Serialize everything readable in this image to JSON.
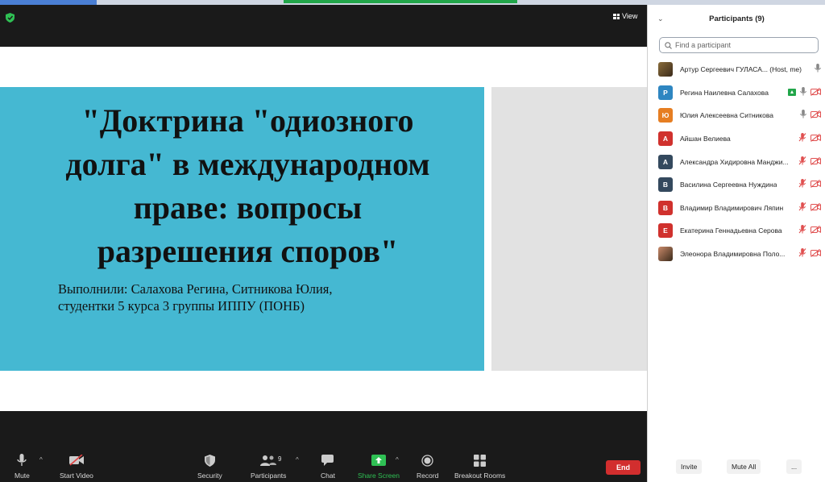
{
  "view_button": {
    "label": "View"
  },
  "slide": {
    "title_lines": [
      "\"Доктрина \"одиозного",
      "долга\" в международном",
      "праве: вопросы",
      "разрешения споров\""
    ],
    "authors_lines": [
      "Выполнили: Салахова Регина, Ситникова Юлия,",
      "студентки 5 курса 3 группы ИППУ (ПОНБ)"
    ]
  },
  "toolbar": {
    "mute": "Mute",
    "start_video": "Start Video",
    "security": "Security",
    "participants": "Participants",
    "participants_count": "9",
    "chat": "Chat",
    "share_screen": "Share Screen",
    "record": "Record",
    "breakout_rooms": "Breakout Rooms",
    "end": "End"
  },
  "panel": {
    "title": "Participants (9)",
    "search_placeholder": "Find a participant",
    "participants": [
      {
        "name": "Артур Сергеевич ГУЛАСА... (Host, me)",
        "initial": "",
        "color": "#8a6d3b",
        "photo": true,
        "sharing": false,
        "mic": "on",
        "video": "none"
      },
      {
        "name": "Регина Наилевна Салахова",
        "initial": "Р",
        "color": "#2e86c1",
        "photo": false,
        "sharing": true,
        "mic": "on",
        "video": "off"
      },
      {
        "name": "Юлия Алексеевна Ситникова",
        "initial": "Ю",
        "color": "#e67e22",
        "photo": false,
        "sharing": false,
        "mic": "on",
        "video": "off"
      },
      {
        "name": "Айшан Велиева",
        "initial": "А",
        "color": "#d0312d",
        "photo": false,
        "sharing": false,
        "mic": "muted",
        "video": "off"
      },
      {
        "name": "Александра Хидировна Манджи...",
        "initial": "А",
        "color": "#34495e",
        "photo": false,
        "sharing": false,
        "mic": "muted",
        "video": "off"
      },
      {
        "name": "Василина Сергеевна Нуждина",
        "initial": "В",
        "color": "#34495e",
        "photo": false,
        "sharing": false,
        "mic": "muted",
        "video": "off"
      },
      {
        "name": "Владимир Владимирович Ляпин",
        "initial": "В",
        "color": "#d0312d",
        "photo": false,
        "sharing": false,
        "mic": "muted",
        "video": "off"
      },
      {
        "name": "Екатерина Геннадьевна Серова",
        "initial": "Е",
        "color": "#d0312d",
        "photo": false,
        "sharing": false,
        "mic": "muted",
        "video": "off"
      },
      {
        "name": "Элеонора Владимировна Поло...",
        "initial": "",
        "color": "#c98a6b",
        "photo": true,
        "sharing": false,
        "mic": "muted",
        "video": "off"
      }
    ],
    "invite": "Invite",
    "mute_all": "Mute All",
    "more": "..."
  },
  "colors": {
    "accent_green": "#22a64a",
    "end_red": "#d22e2e",
    "slide_blue": "#45b8d2"
  }
}
